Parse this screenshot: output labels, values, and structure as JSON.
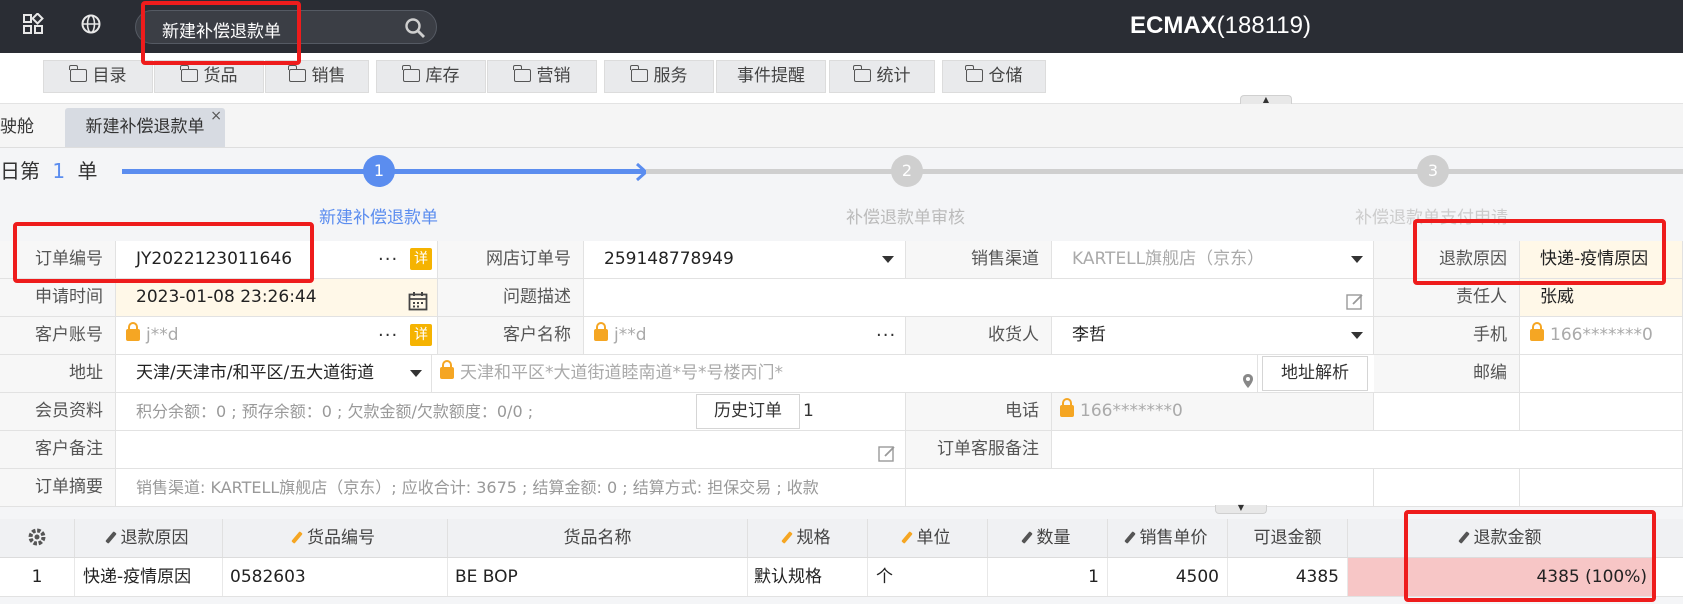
{
  "header": {
    "search_value": "新建补偿退款单",
    "brand_name": "ECMAX",
    "brand_id": "(188119)"
  },
  "menu": [
    {
      "label": "目录",
      "icon": "folder-icon"
    },
    {
      "label": "货品",
      "icon": "folder-icon"
    },
    {
      "label": "销售",
      "icon": "folder-icon"
    },
    {
      "label": "库存",
      "icon": "folder-icon"
    },
    {
      "label": "营销",
      "icon": "folder-icon"
    },
    {
      "label": "服务",
      "icon": "folder-icon"
    },
    {
      "label": "事件提醒",
      "icon": ""
    },
    {
      "label": "统计",
      "icon": "folder-icon"
    },
    {
      "label": "仓储",
      "icon": "folder-icon"
    }
  ],
  "tabs": [
    {
      "label": "驶舱"
    },
    {
      "label": "新建补偿退款单",
      "close": "×"
    }
  ],
  "steps": {
    "prefix_text": "日第",
    "prefix_num": "1",
    "prefix_unit": "单",
    "items": [
      {
        "num": "1",
        "label": "新建补偿退款单"
      },
      {
        "num": "2",
        "label": "补偿退款单审核"
      },
      {
        "num": "3",
        "label": "补偿退款单支付申请"
      }
    ]
  },
  "form": {
    "order_no_label": "订单编号",
    "order_no": "JY2022123011646",
    "detail_badge": "详",
    "shop_order_label": "网店订单号",
    "shop_order": "259148778949",
    "channel_label": "销售渠道",
    "channel": "KARTELL旗舰店（京东）",
    "refund_reason_label": "退款原因",
    "refund_reason": "快递-疫情原因",
    "apply_time_label": "申请时间",
    "apply_time": "2023-01-08 23:26:44",
    "problem_label": "问题描述",
    "owner_label": "责任人",
    "owner": "张威",
    "account_label": "客户账号",
    "account": "j**d",
    "customer_name_label": "客户名称",
    "customer_name": "j**d",
    "receiver_label": "收货人",
    "receiver": "李哲",
    "mobile_label": "手机",
    "mobile": "166*******0",
    "address_label": "地址",
    "address_region": "天津/天津市/和平区/五大道街道",
    "address_detail": "天津和平区*大道街道睦南道*号*号楼丙门*",
    "address_parse_button": "地址解析",
    "postcode_label": "邮编",
    "member_label": "会员资料",
    "member_info": "积分余额：0 ; 预存余额：0 ; 欠款金额/欠款额度：0/0 ;",
    "history_button": "历史订单",
    "history_count": "1",
    "phone_label": "电话",
    "phone": "166*******0",
    "customer_note_label": "客户备注",
    "order_cs_note_label": "订单客服备注",
    "summary_label": "订单摘要",
    "summary": "销售渠道: KARTELL旗舰店（京东）; 应收合计: 3675 ; 结算金额: 0 ; 结算方式: 担保交易 ; 收款"
  },
  "table": {
    "columns": [
      "退款原因",
      "货品编号",
      "货品名称",
      "规格",
      "单位",
      "数量",
      "销售单价",
      "可退金额",
      "退款金额"
    ],
    "rows": [
      {
        "idx": "1",
        "reason": "快递-疫情原因",
        "code": "0582603",
        "name": "BE BOP",
        "spec": "默认规格",
        "unit": "个",
        "qty": "1",
        "price": "4500",
        "refundable": "4385",
        "refund": "4385 (100%)"
      }
    ]
  },
  "colors": {
    "accent": "#5b8def",
    "highlight_red": "#ee1c1c",
    "badge_yellow": "#f5b301",
    "refund_cell": "#f7c6c6"
  }
}
